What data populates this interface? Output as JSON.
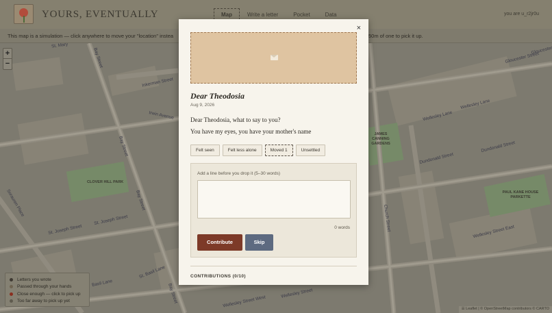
{
  "header": {
    "title": "YOURS, EVENTUALLY",
    "nav": [
      "Map",
      "Write a letter",
      "Pocket",
      "Data"
    ],
    "active_tab": "Map",
    "user": "you are u_r2jr0u"
  },
  "info_bar": "This map is a simulation — click anywhere to move your \"location\" instea",
  "info_bar_tail": "50m of one to pick it up.",
  "map": {
    "streets": [
      "St. Mary",
      "Bay Street",
      "Inkerman Street",
      "Irwin Avenue",
      "Gloucester Street",
      "Wellesley Lane",
      "Wellesley Lane",
      "Dundonald Street",
      "Dundonald Street",
      "Bay Street",
      "Bay Street",
      "St. Joseph Street",
      "St. Joseph Street",
      "St. Basil Lane",
      "Basil Lane",
      "Wellesley Street",
      "Wellesley Street West",
      "Wellesley Street East",
      "Church Street",
      "Gloucester Street",
      "Sorauren Place",
      "Bay Street"
    ],
    "parks": [
      "CLOVER HILL PARK",
      "JAMES CANNING GARDENS",
      "PAUL KANE HOUSE PARKETTE"
    ],
    "zoom_in": "+",
    "zoom_out": "−",
    "legend": [
      {
        "label": "Letters you wrote",
        "color": "#3f3a33"
      },
      {
        "label": "Passed through your hands",
        "color": "#6f6452"
      },
      {
        "label": "Close enough — click to pick up",
        "color": "#8a2f20"
      },
      {
        "label": "Too far away to pick up yet",
        "color": "#5f5a4e"
      }
    ],
    "attribution": "☰ Leaflet | © OpenStreetMap contributors © CARTO"
  },
  "modal": {
    "close": "×",
    "greeting": "Dear Theodosia",
    "date": "Aug 9, 2026",
    "line1": "Dear Theodosia, what to say to you?",
    "line2": "You have my eyes, you have your mother's name",
    "reactions": [
      "Felt seen",
      "Felt less alone",
      "Moved 1",
      "Unsettled"
    ],
    "selected_reaction": "Moved 1",
    "add_label": "Add a line before you drop it (5–30 words)",
    "textarea_value": "",
    "word_count": "0 words",
    "contribute_label": "Contribute",
    "skip_label": "Skip",
    "contributions_label": "CONTRIBUTIONS (0/10)"
  }
}
